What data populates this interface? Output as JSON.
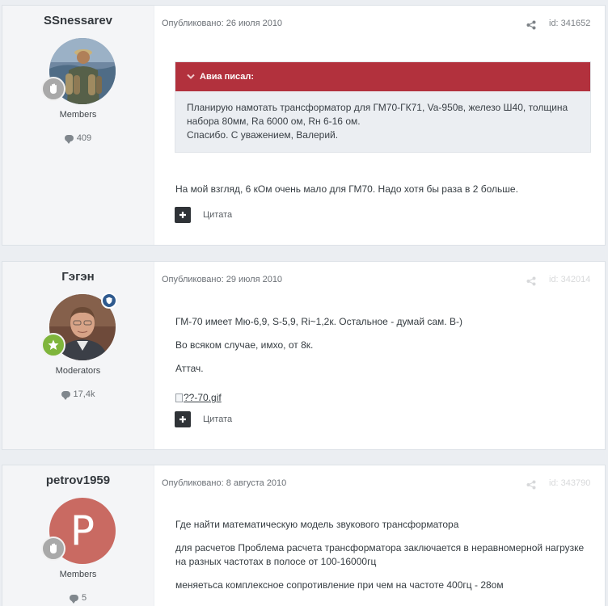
{
  "posts": [
    {
      "author": "SSnessarev",
      "group": "Members",
      "post_count": "409",
      "date": "Опубликовано: 26 июля 2010",
      "id": "id: 341652",
      "quote": {
        "author": "Авиа писал:",
        "lines": [
          "Планирую намотать трансформатор для ГМ70-ГК71, Va-950в, железо Ш40, толщина",
          "набора 80мм, Ra 6000 ом, Rн 6-16 ом.",
          "Спасибо. С уважением, Валерий."
        ]
      },
      "paragraphs": [
        "На мой взгляд, 6 кОм очень мало для ГМ70. Надо хотя бы раза в 2 больше."
      ],
      "quote_label": "Цитата"
    },
    {
      "author": "Гэгэн",
      "group": "Moderators",
      "post_count": "17,4k",
      "date": "Опубликовано: 29 июля 2010",
      "id": "id: 342014",
      "paragraphs": [
        "ГМ-70 имеет Мю-6,9, S-5,9, Ri~1,2к. Остальное - думай сам. В-)",
        "Во всяком случае, имхо, от 8к.",
        "Аттач."
      ],
      "attachment": "??-70.gif",
      "quote_label": "Цитата"
    },
    {
      "author": "petrov1959",
      "avatar_letter": "P",
      "group": "Members",
      "post_count": "5",
      "date": "Опубликовано: 8 августа 2010",
      "id": "id: 343790",
      "paragraphs": [
        "Где найти математическую модель звукового трансформатора",
        "для расчетов Проблема расчета трансформатора заключается в неравномерной нагрузке",
        "на разных частотах в полосе от 100-16000гц",
        "меняетьса комплексное сопротивление при чем на частоте 400гц - 28ом"
      ]
    }
  ],
  "colors": {
    "quote_header": "#b2313d",
    "letter_avatar": "#c96a62",
    "mod_badge": "#7fb53c",
    "member_badge": "#a9a9a9"
  }
}
